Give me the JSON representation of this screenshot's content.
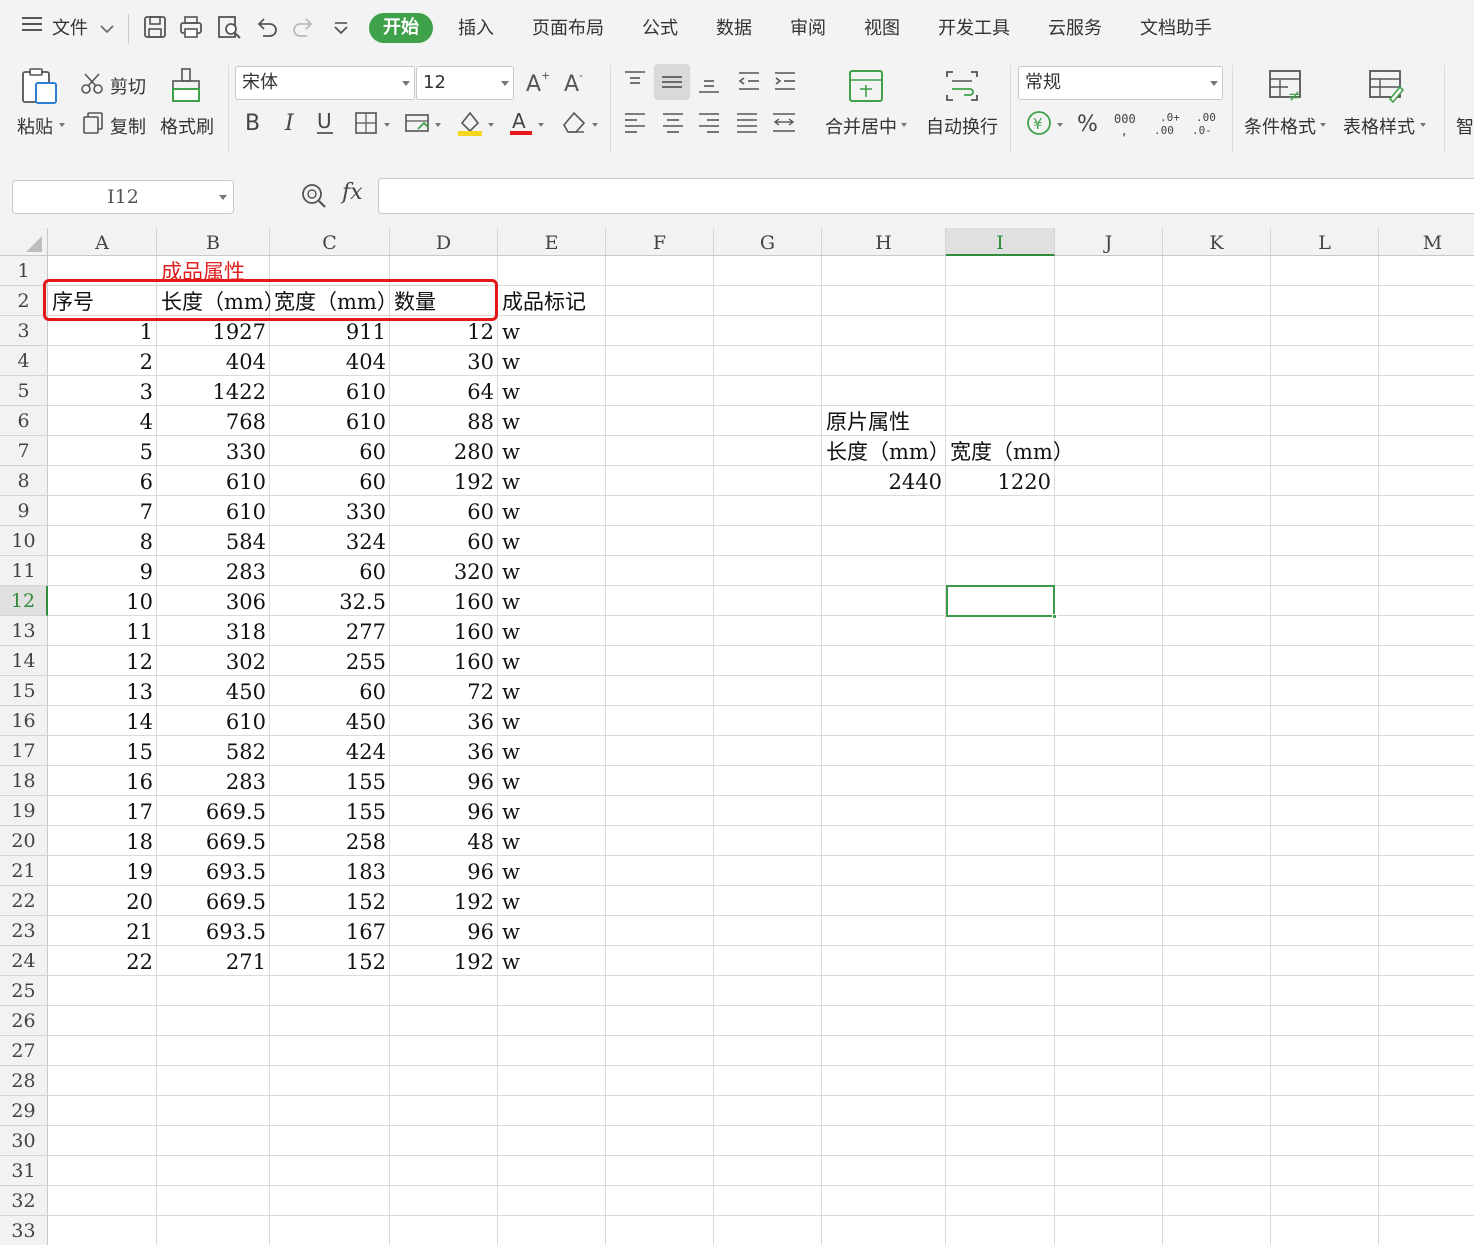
{
  "menu": {
    "file": "文件",
    "tabs": [
      "开始",
      "插入",
      "页面布局",
      "公式",
      "数据",
      "审阅",
      "视图",
      "开发工具",
      "云服务",
      "文档助手"
    ]
  },
  "ribbon": {
    "paste": "粘贴",
    "cut": "剪切",
    "copy": "复制",
    "format_painter": "格式刷",
    "font_name": "宋体",
    "font_size": "12",
    "merge_center": "合并居中",
    "wrap_text": "自动换行",
    "number_format": "常规",
    "conditional_format": "条件格式",
    "table_style": "表格样式",
    "cut_off": "智"
  },
  "formula_bar": {
    "name_box": "I12",
    "fx": "fx",
    "content": ""
  },
  "columns": [
    "A",
    "B",
    "C",
    "D",
    "E",
    "F",
    "G",
    "H",
    "I",
    "J",
    "K",
    "L",
    "M"
  ],
  "selected_column": "I",
  "selected_row": 12,
  "rows": [
    "1",
    "2",
    "3",
    "4",
    "5",
    "6",
    "7",
    "8",
    "9",
    "10",
    "11",
    "12",
    "13",
    "14",
    "15",
    "16",
    "17",
    "18",
    "19",
    "20",
    "21",
    "22",
    "23",
    "24",
    "25",
    "26",
    "27",
    "28",
    "29",
    "30",
    "31",
    "32",
    "33"
  ],
  "sheet": {
    "row1": {
      "B": "成品属性"
    },
    "header": {
      "A": "序号",
      "B": "长度（mm）",
      "C": "宽度（mm）",
      "D": "数量",
      "E": "成品标记"
    },
    "data": [
      [
        "1",
        "1927",
        "911",
        "12",
        "w"
      ],
      [
        "2",
        "404",
        "404",
        "30",
        "w"
      ],
      [
        "3",
        "1422",
        "610",
        "64",
        "w"
      ],
      [
        "4",
        "768",
        "610",
        "88",
        "w"
      ],
      [
        "5",
        "330",
        "60",
        "280",
        "w"
      ],
      [
        "6",
        "610",
        "60",
        "192",
        "w"
      ],
      [
        "7",
        "610",
        "330",
        "60",
        "w"
      ],
      [
        "8",
        "584",
        "324",
        "60",
        "w"
      ],
      [
        "9",
        "283",
        "60",
        "320",
        "w"
      ],
      [
        "10",
        "306",
        "32.5",
        "160",
        "w"
      ],
      [
        "11",
        "318",
        "277",
        "160",
        "w"
      ],
      [
        "12",
        "302",
        "255",
        "160",
        "w"
      ],
      [
        "13",
        "450",
        "60",
        "72",
        "w"
      ],
      [
        "14",
        "610",
        "450",
        "36",
        "w"
      ],
      [
        "15",
        "582",
        "424",
        "36",
        "w"
      ],
      [
        "16",
        "283",
        "155",
        "96",
        "w"
      ],
      [
        "17",
        "669.5",
        "155",
        "96",
        "w"
      ],
      [
        "18",
        "669.5",
        "258",
        "48",
        "w"
      ],
      [
        "19",
        "693.5",
        "183",
        "96",
        "w"
      ],
      [
        "20",
        "669.5",
        "152",
        "192",
        "w"
      ],
      [
        "21",
        "693.5",
        "167",
        "96",
        "w"
      ],
      [
        "22",
        "271",
        "152",
        "192",
        "w"
      ]
    ],
    "raw": {
      "title": "原片属性",
      "length_label": "长度（mm）",
      "width_label": "宽度（mm）",
      "length": "2440",
      "width": "1220"
    }
  },
  "colors": {
    "accent": "#3fa14a",
    "highlight": "#e81717",
    "title_red": "#e02020"
  }
}
